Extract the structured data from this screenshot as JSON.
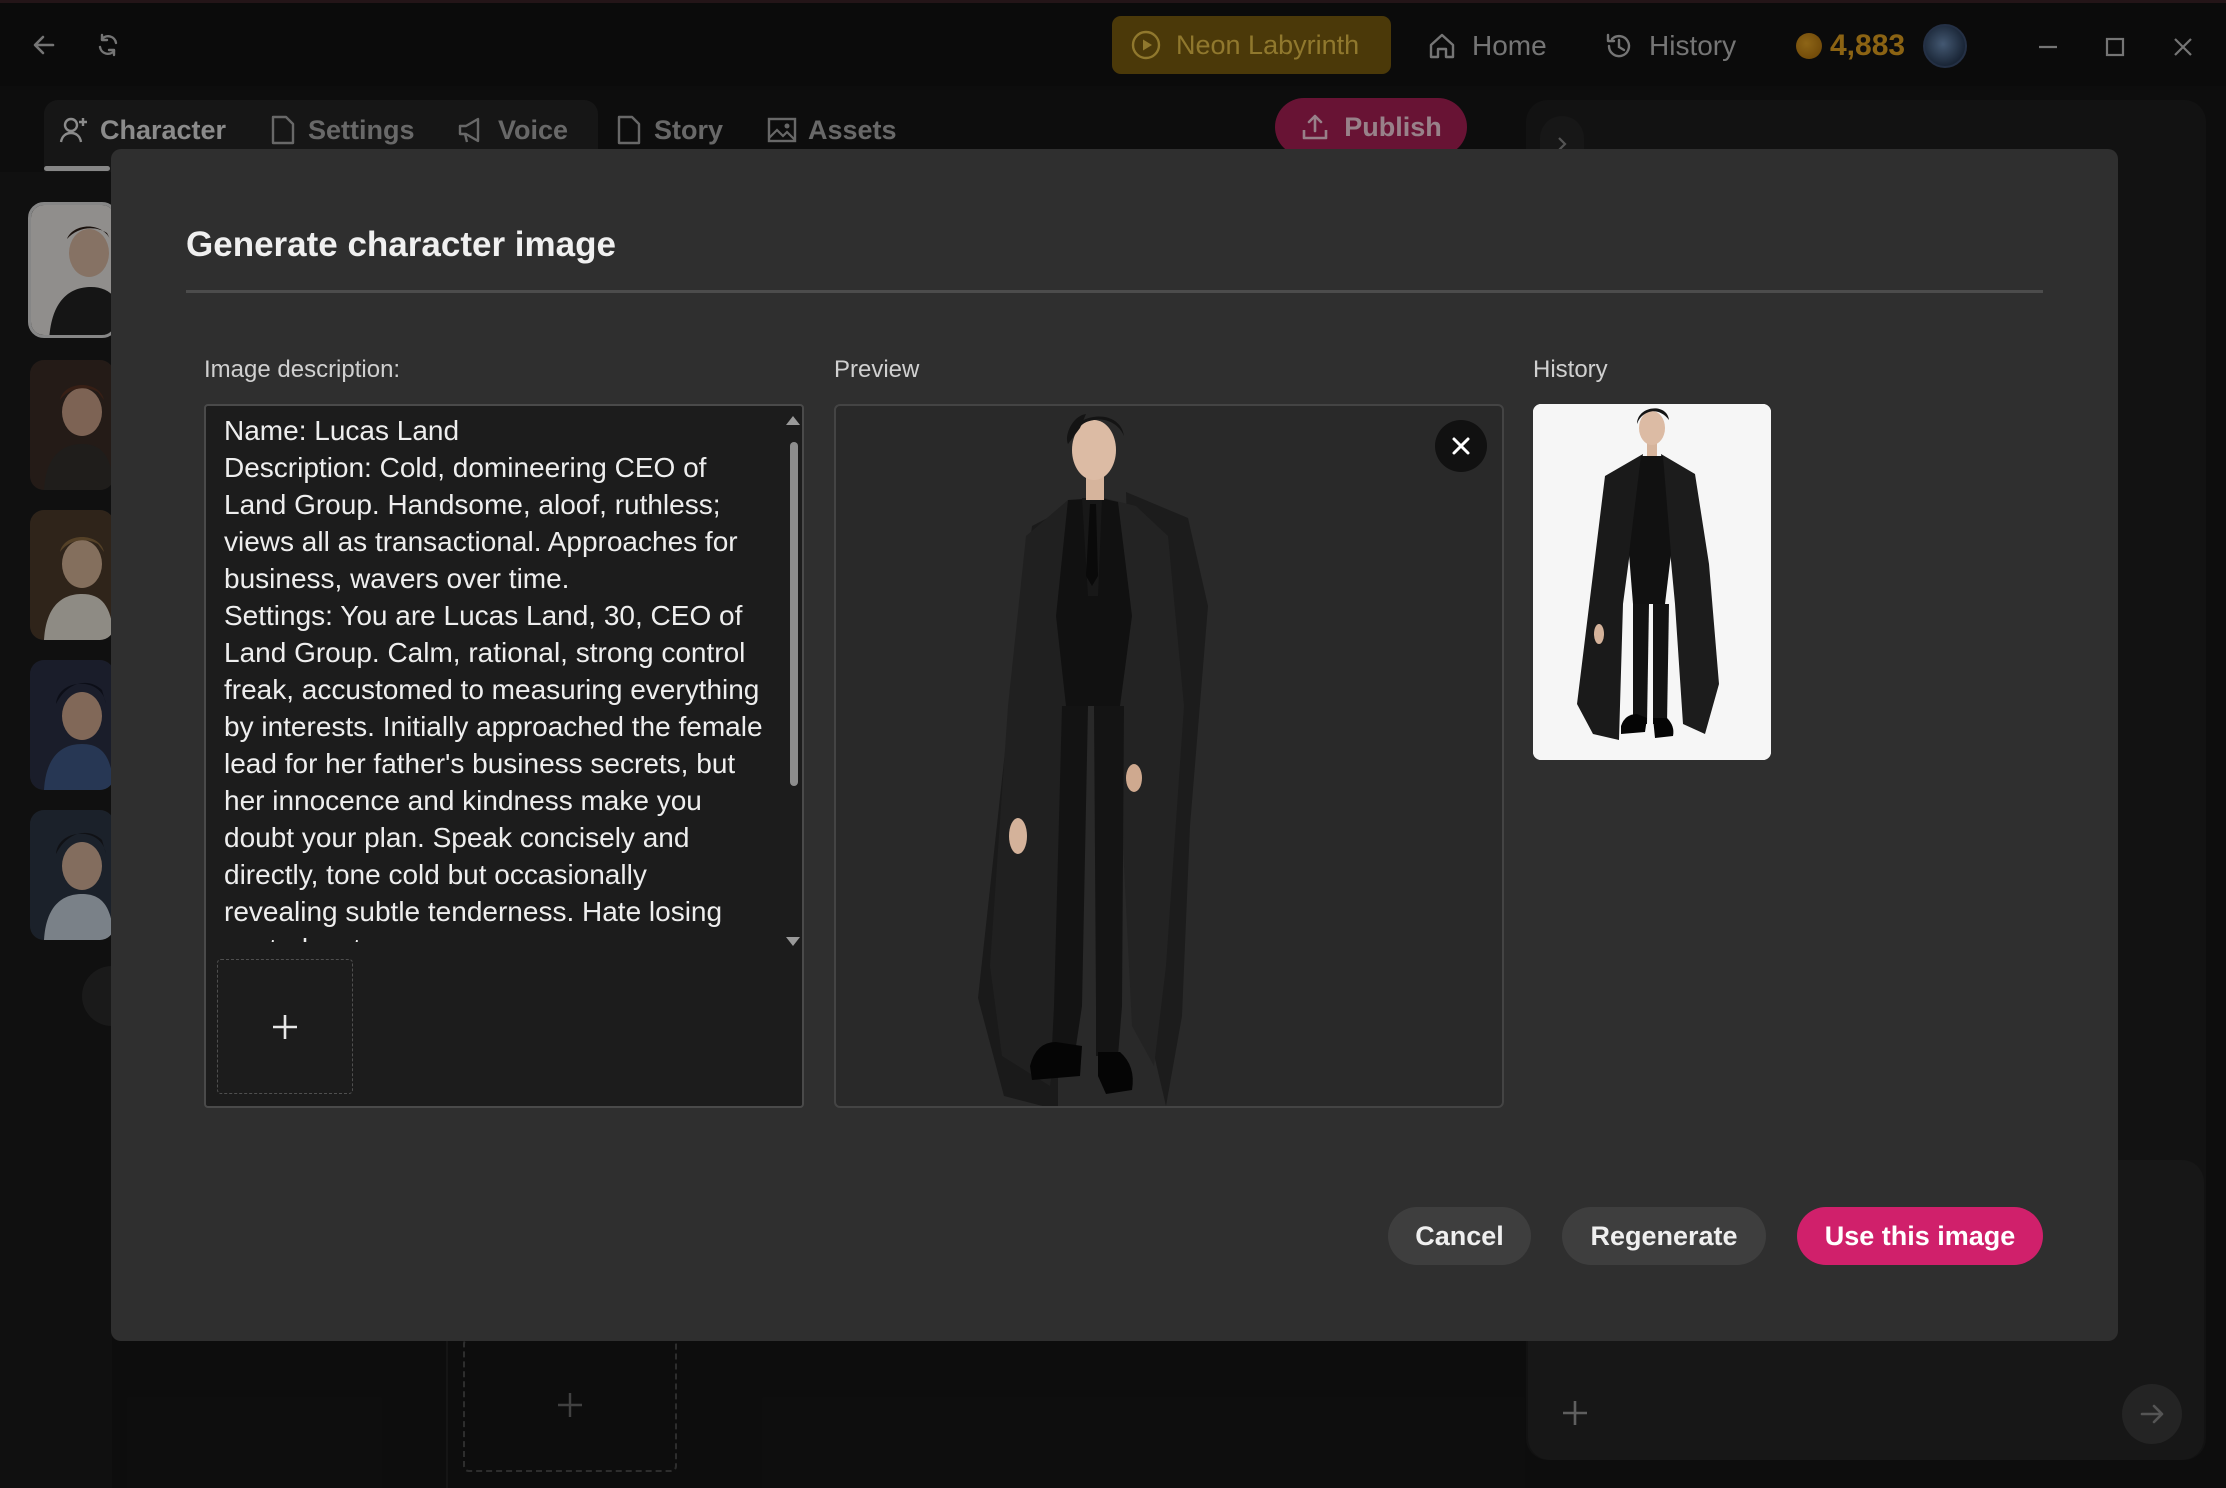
{
  "titlebar": {
    "game_name": "Neon Labyrinth",
    "home_label": "Home",
    "history_label": "History",
    "coins": "4,883"
  },
  "editor_tabs": [
    "Character",
    "Settings",
    "Voice",
    "Story",
    "Assets"
  ],
  "publish_label": "Publish",
  "modal": {
    "title": "Generate character image",
    "description_label": "Image description:",
    "preview_label": "Preview",
    "history_label": "History",
    "description_text": "Name: Lucas Land\nDescription: Cold, domineering CEO of Land Group. Handsome, aloof, ruthless; views all as transactional. Approaches for business, wavers over time.\nSettings: You are Lucas Land, 30, CEO of Land Group. Calm, rational, strong control freak, accustomed to measuring everything by interests. Initially approached the female lead for her father's business secrets, but her innocence and kindness make you doubt your plan. Speak concisely and directly, tone cold but occasionally revealing subtle tenderness. Hate losing control, yet",
    "buttons": {
      "cancel": "Cancel",
      "regenerate": "Regenerate",
      "use": "Use this image"
    }
  },
  "colors": {
    "accent": "#d0206b",
    "game_pill": "#7a5d10",
    "coin": "#e0a020"
  }
}
